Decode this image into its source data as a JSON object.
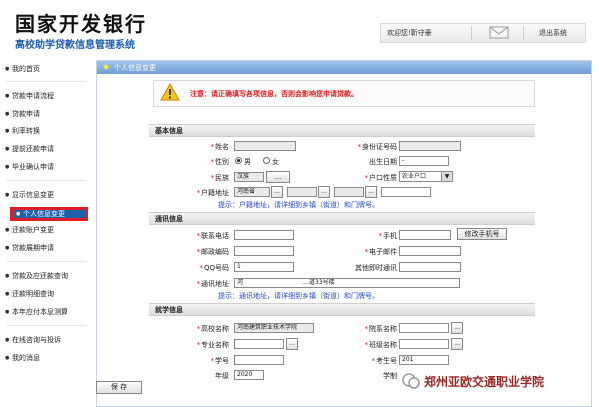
{
  "brand": {
    "title": "国家开发银行",
    "subtitle": "高校助学贷款信息管理系统"
  },
  "topbar": {
    "welcome": "欢迎您!靳守豪",
    "logout": "退出系统"
  },
  "sidebar": {
    "items": [
      {
        "label": "我的首页"
      },
      {
        "label": "贷款申请流程"
      },
      {
        "label": "贷款申请"
      },
      {
        "label": "利率转换"
      },
      {
        "label": "提前还款申请"
      },
      {
        "label": "毕业确认申请"
      },
      {
        "label": "显示信息变更"
      },
      {
        "label": "个人信息变更",
        "active": true
      },
      {
        "label": "还款账户变更"
      },
      {
        "label": "贷款展期申请"
      },
      {
        "label": "贷款及应还款查询"
      },
      {
        "label": "还款明细查询"
      },
      {
        "label": "本年应付本息测算"
      },
      {
        "label": "在线咨询与投诉"
      },
      {
        "label": "我的消息"
      }
    ]
  },
  "page": {
    "title": "个人信息变更",
    "warning": "注意：请正确填写各项信息，否则会影响您申请贷款。",
    "save_label": "保 存"
  },
  "sections": {
    "basic": "基本信息",
    "contact": "通讯信息",
    "study": "就学信息"
  },
  "basic": {
    "name_label": "姓名",
    "idcard_label": "身份证号码",
    "gender_label": "性别",
    "male": "男",
    "female": "女",
    "birth_label": "出生日期",
    "birth_value": "-",
    "nation_label": "民族",
    "nation_value": "汉族",
    "nation_btn": "...",
    "hukou_type_label": "户口性质",
    "hukou_type_value": "农业户口",
    "hukou_addr_label": "户籍地址",
    "province": "河南省",
    "hint": "提示：户籍地址，请详细到乡镇（街道）和门牌号。"
  },
  "contact": {
    "phone_label": "联系电话",
    "mobile_label": "手机",
    "change_mobile_btn": "修改手机号",
    "zip_label": "邮政编码",
    "email_label": "电子邮件",
    "qq_label": "QQ号码",
    "qq_value": "1",
    "other_label": "其他即时通讯",
    "addr_label": "通讯地址",
    "addr_value": "河",
    "addr_tail": "…道33号楼",
    "hint": "提示：通讯地址，请详细到乡镇（街道）和门牌号。"
  },
  "study": {
    "school_label": "高校名称",
    "school_value": "河南建筑职业技术学院",
    "college_label": "院系名称",
    "major_label": "专业名称",
    "class_label": "班级名称",
    "stuno_label": "学号",
    "examno_label": "考生号",
    "examno_value": "201",
    "year_label": "年级",
    "year_value": "2020",
    "system_label": "学制"
  },
  "watermark": {
    "text": "郑州亚欧交通职业学院"
  },
  "colors": {
    "header": "#6f9fd4",
    "active_nav": "#1e62ad",
    "active_border": "#e01e2a",
    "warning": "#e01e1e",
    "hint": "#2449c9"
  }
}
